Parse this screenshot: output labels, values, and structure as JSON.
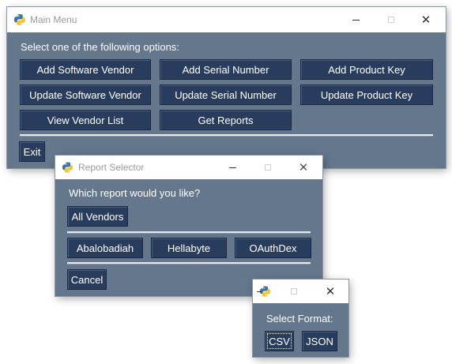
{
  "main_window": {
    "title": "Main Menu",
    "prompt": "Select one of the following options:",
    "buttons": {
      "add_vendor": "Add Software Vendor",
      "add_serial": "Add Serial Number",
      "add_key": "Add Product Key",
      "update_vendor": "Update Software Vendor",
      "update_serial": "Update Serial Number",
      "update_key": "Update Product Key",
      "view_vendors": "View Vendor List",
      "get_reports": "Get Reports",
      "exit": "Exit"
    }
  },
  "report_window": {
    "title": "Report Selector",
    "prompt": "Which report would you like?",
    "buttons": {
      "all_vendors": "All Vendors",
      "vendor_1": "Abalobadiah",
      "vendor_2": "Hellabyte",
      "vendor_3": "OAuthDex",
      "cancel": "Cancel"
    }
  },
  "format_window": {
    "prompt": "Select Format:",
    "buttons": {
      "csv": "CSV",
      "json": "JSON"
    }
  },
  "theme": {
    "window_bg": "#64778d",
    "button_bg": "#283d5e",
    "titlebar_bg": "#ffffff"
  },
  "icons": {
    "app": "python-logo-icon",
    "minimize": "minimize-icon",
    "maximize": "maximize-icon",
    "close": "close-icon"
  }
}
